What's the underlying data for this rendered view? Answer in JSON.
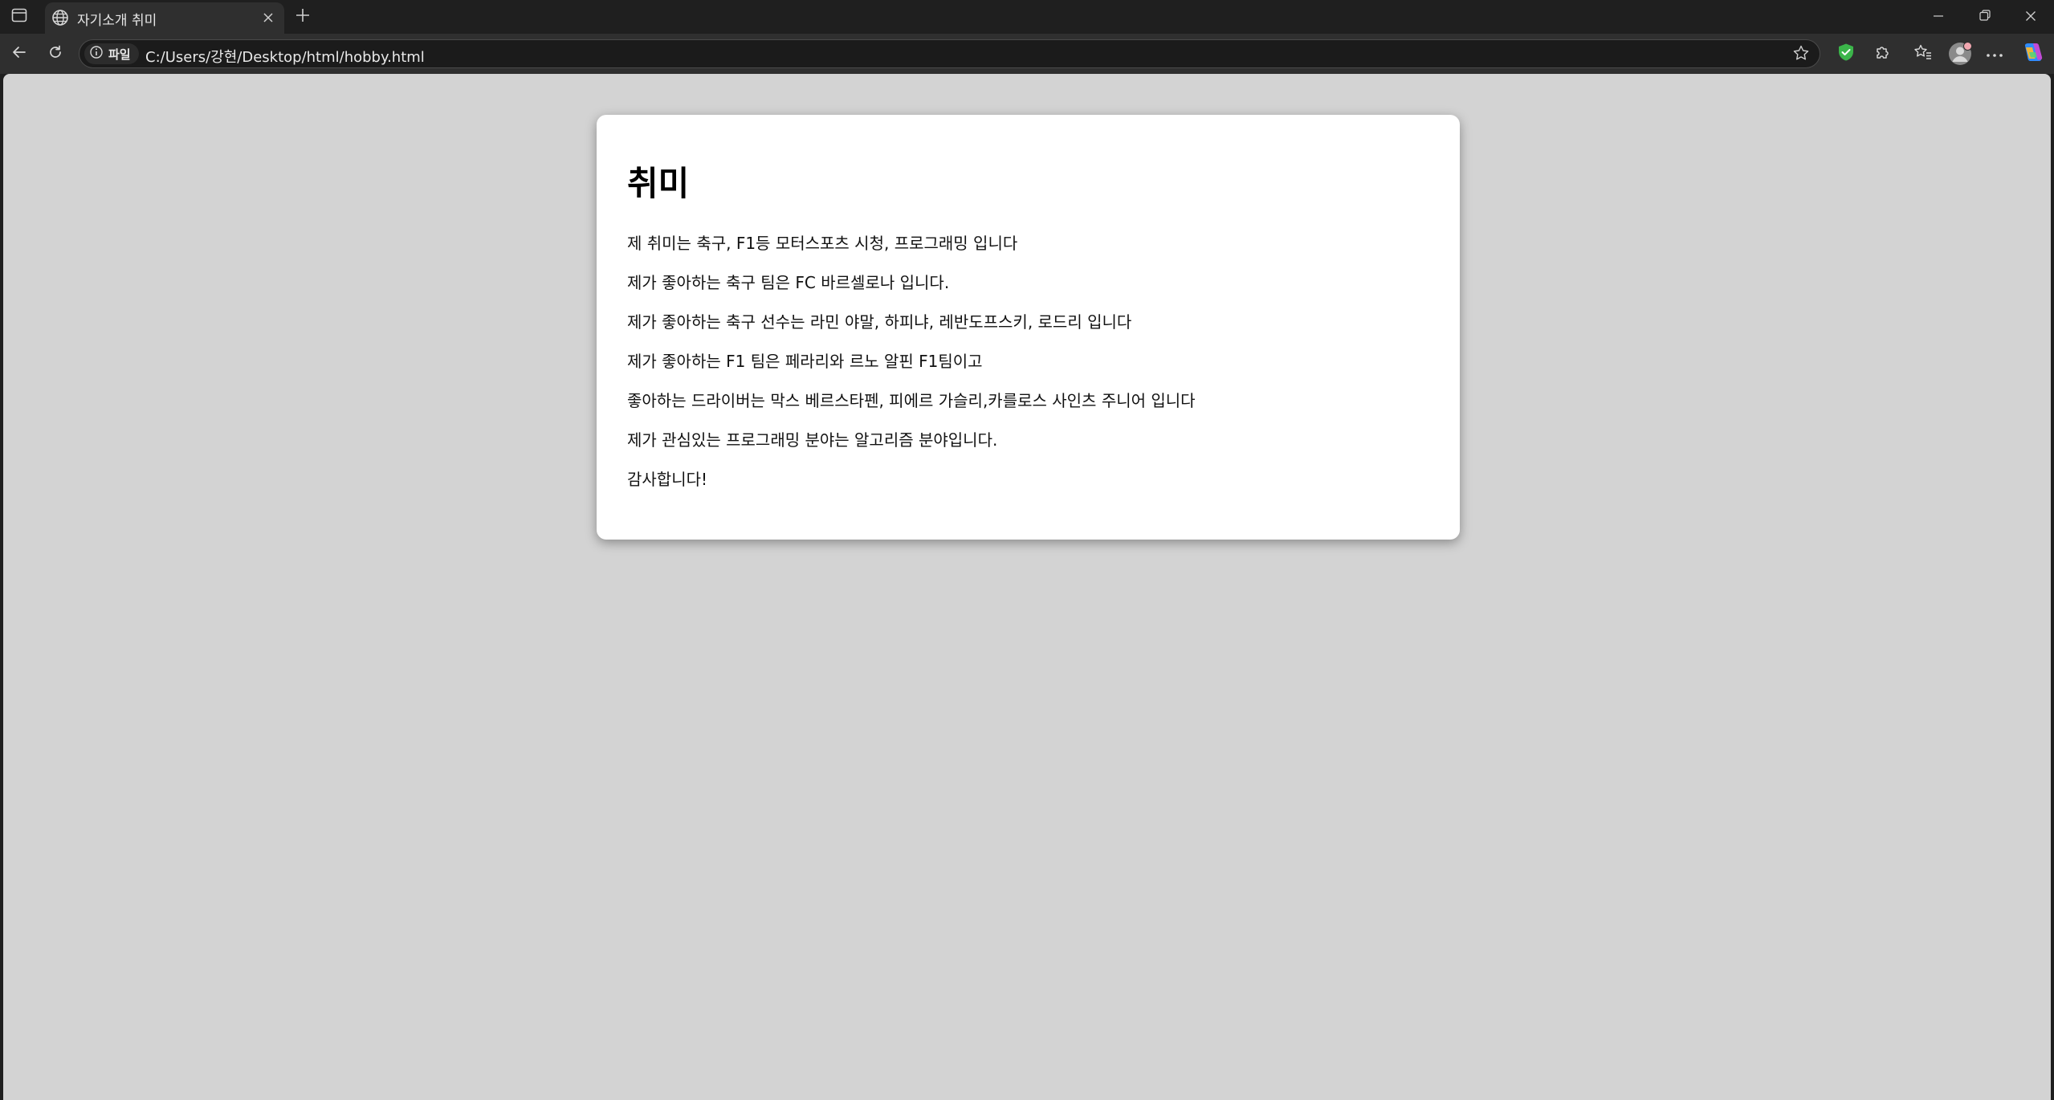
{
  "browser": {
    "tab": {
      "title": "자기소개 취미"
    },
    "address_bar": {
      "site_info_label": "파일",
      "url": "C:/Users/강현/Desktop/html/hobby.html"
    }
  },
  "icons": {
    "tab_actions": "tab-actions-icon",
    "favicon": "globe-icon",
    "close": "close-icon",
    "new_tab": "plus-icon",
    "back": "back-arrow-icon",
    "refresh": "refresh-icon",
    "info": "info-icon",
    "favorite": "star-icon",
    "shield": "shield-extension-icon",
    "extensions": "puzzle-icon",
    "favorites": "favorites-icon",
    "profile": "profile-avatar-icon",
    "more": "more-icon",
    "copilot": "copilot-icon"
  },
  "colors": {
    "page_background": "#d3d3d3",
    "card_background": "#ffffff",
    "shield_green": "#3bb54a"
  },
  "page": {
    "heading": "취미",
    "paragraphs": [
      "제 취미는 축구, F1등 모터스포츠 시청, 프로그래밍 입니다",
      "제가 좋아하는 축구 팀은 FC 바르셀로나 입니다.",
      "제가 좋아하는 축구 선수는 라민 야말, 하피냐, 레반도프스키, 로드리 입니다",
      "제가 좋아하는 F1 팀은 페라리와 르노 알핀 F1팀이고",
      "좋아하는 드라이버는 막스 베르스타펜, 피에르 가슬리,카를로스 사인츠 주니어 입니다",
      "제가 관심있는 프로그래밍 분야는 알고리즘 분야입니다.",
      "감사합니다!"
    ]
  }
}
